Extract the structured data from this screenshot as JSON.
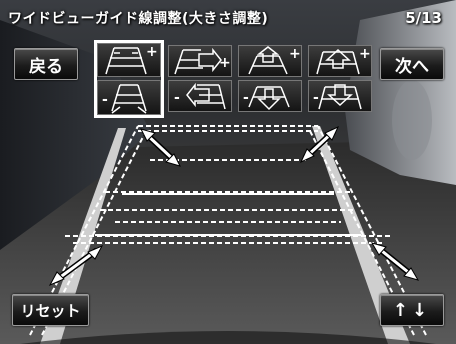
{
  "header": {
    "title": "ワイドビューガイド線調整(大きさ調整)",
    "page_indicator": "5/13"
  },
  "buttons": {
    "back": "戻る",
    "next": "次へ",
    "reset": "リセット",
    "up_down": "↑↓"
  },
  "tools": {
    "row1": [
      {
        "icon": "widen-guide-icon",
        "sign": "+"
      },
      {
        "icon": "extend-right-guide-icon",
        "sign": "+"
      },
      {
        "icon": "raise-guide-icon",
        "sign": "+"
      },
      {
        "icon": "lengthen-guide-icon",
        "sign": "+"
      }
    ],
    "row2": [
      {
        "icon": "narrow-guide-icon",
        "sign": "-"
      },
      {
        "icon": "shrink-left-guide-icon",
        "sign": "-"
      },
      {
        "icon": "lower-guide-icon",
        "sign": "-"
      },
      {
        "icon": "shorten-guide-icon",
        "sign": "-"
      }
    ],
    "selected_index": 0
  },
  "colors": {
    "guide_line": "#ffffff",
    "selection": "#ffffff",
    "button_text": "#ffffff"
  }
}
